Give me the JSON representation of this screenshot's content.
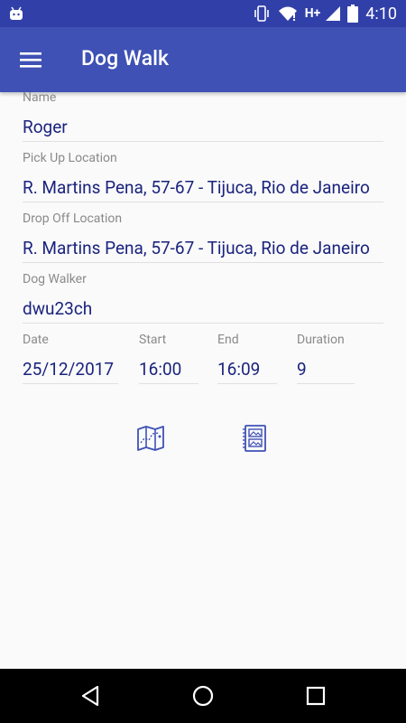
{
  "status_bar": {
    "network": "H+",
    "time": "4:10"
  },
  "app_bar": {
    "title": "Dog Walk"
  },
  "form": {
    "name": {
      "label": "Name",
      "value": "Roger"
    },
    "pickup": {
      "label": "Pick Up Location",
      "value": "R. Martins Pena, 57-67 - Tijuca, Rio de Janeiro"
    },
    "dropoff": {
      "label": "Drop Off Location",
      "value": "R. Martins Pena, 57-67 - Tijuca, Rio de Janeiro"
    },
    "walker": {
      "label": "Dog Walker",
      "value": "dwu23ch"
    },
    "date": {
      "label": "Date",
      "value": "25/12/2017"
    },
    "start": {
      "label": "Start",
      "value": "16:00"
    },
    "end": {
      "label": "End",
      "value": "16:09"
    },
    "duration": {
      "label": "Duration",
      "value": "9"
    }
  },
  "icons": {
    "accent": "#3f51b5",
    "actions": [
      "map-icon",
      "gallery-icon"
    ]
  },
  "colors": {
    "status_bar": "#3140a8",
    "app_bar": "#3f51b5",
    "value_text": "#1a237e",
    "label_text": "#8a8a8a"
  }
}
